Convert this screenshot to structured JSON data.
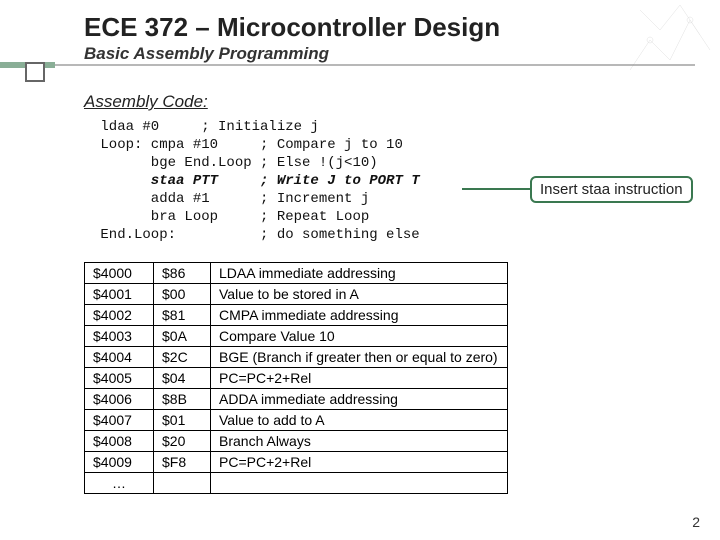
{
  "title": "ECE 372 – Microcontroller Design",
  "subtitle": "Basic Assembly Programming",
  "section": "Assembly Code:",
  "code_lines": [
    " ldaa #0     ; Initialize j",
    " Loop: cmpa #10     ; Compare j to 10",
    "       bge End.Loop ; Else !(j<10)",
    "       staa PTT     ; Write J to PORT T",
    "       adda #1      ; Increment j",
    "       bra Loop     ; Repeat Loop",
    " End.Loop:          ; do something else"
  ],
  "bold_line_index": 3,
  "callout": "Insert staa instruction",
  "table": [
    {
      "addr": "$4000",
      "opc": "$86",
      "desc": "LDAA immediate addressing"
    },
    {
      "addr": "$4001",
      "opc": "$00",
      "desc": "Value to be stored in A"
    },
    {
      "addr": "$4002",
      "opc": "$81",
      "desc": "CMPA immediate addressing"
    },
    {
      "addr": "$4003",
      "opc": "$0A",
      "desc": "Compare Value 10"
    },
    {
      "addr": "$4004",
      "opc": "$2C",
      "desc": "BGE (Branch if greater then or equal to zero)"
    },
    {
      "addr": "$4005",
      "opc": "$04",
      "desc": "PC=PC+2+Rel"
    },
    {
      "addr": "$4006",
      "opc": "$8B",
      "desc": "ADDA immediate addressing"
    },
    {
      "addr": "$4007",
      "opc": "$01",
      "desc": "Value to add to A"
    },
    {
      "addr": "$4008",
      "opc": "$20",
      "desc": "Branch Always"
    },
    {
      "addr": "$4009",
      "opc": "$F8",
      "desc": "PC=PC+2+Rel"
    }
  ],
  "ellipsis": "…",
  "page_number": "2"
}
